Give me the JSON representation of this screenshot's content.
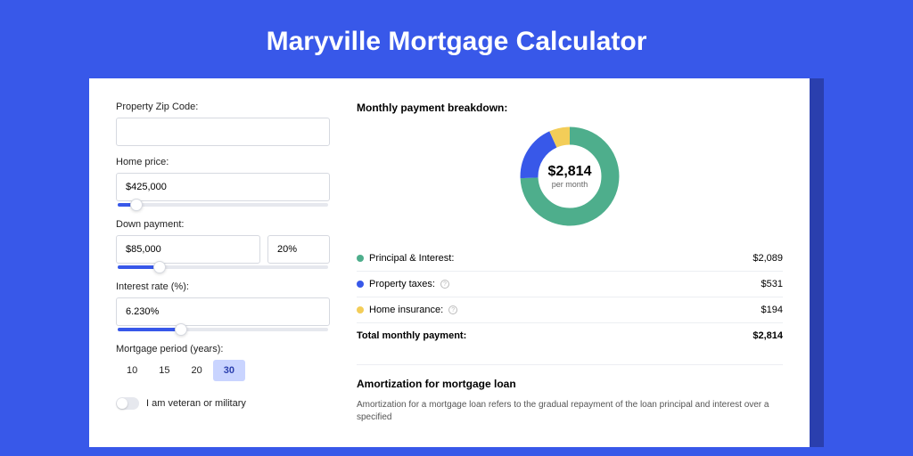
{
  "title": "Maryville Mortgage Calculator",
  "form": {
    "zip_label": "Property Zip Code:",
    "zip_value": "",
    "price_label": "Home price:",
    "price_value": "$425,000",
    "price_slider_pct": 9,
    "down_label": "Down payment:",
    "down_value": "$85,000",
    "down_pct_value": "20%",
    "down_slider_pct": 20,
    "rate_label": "Interest rate (%):",
    "rate_value": "6.230%",
    "rate_slider_pct": 30,
    "period_label": "Mortgage period (years):",
    "periods": [
      "10",
      "15",
      "20",
      "30"
    ],
    "period_active_index": 3,
    "veteran_label": "I am veteran or military"
  },
  "breakdown": {
    "heading": "Monthly payment breakdown:",
    "total": "$2,814",
    "per_month": "per month",
    "items": [
      {
        "label": "Principal & Interest:",
        "value": "$2,089",
        "color": "#4eae8c",
        "info": false,
        "numeric": 2089
      },
      {
        "label": "Property taxes:",
        "value": "$531",
        "color": "#3858e9",
        "info": true,
        "numeric": 531
      },
      {
        "label": "Home insurance:",
        "value": "$194",
        "color": "#f3cd58",
        "info": true,
        "numeric": 194
      }
    ],
    "total_label": "Total monthly payment:",
    "total_value": "$2,814"
  },
  "chart_data": {
    "type": "pie",
    "title": "Monthly payment breakdown",
    "categories": [
      "Principal & Interest",
      "Property taxes",
      "Home insurance"
    ],
    "values": [
      2089,
      531,
      194
    ],
    "colors": [
      "#4eae8c",
      "#3858e9",
      "#f3cd58"
    ],
    "center_label": "$2,814 per month"
  },
  "amort": {
    "heading": "Amortization for mortgage loan",
    "text": "Amortization for a mortgage loan refers to the gradual repayment of the loan principal and interest over a specified"
  }
}
